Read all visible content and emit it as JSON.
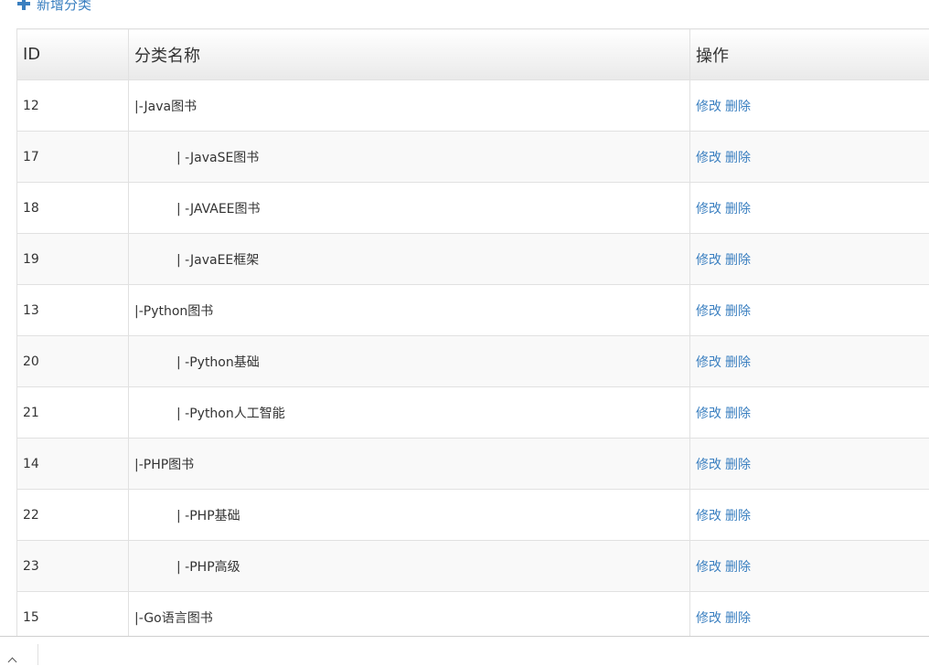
{
  "toolbar": {
    "add_label": "新增分类"
  },
  "table": {
    "headers": {
      "id": "ID",
      "name": "分类名称",
      "actions": "操作"
    },
    "rows": [
      {
        "id": "12",
        "name": "|-Java图书",
        "edit": "修改",
        "delete": "删除"
      },
      {
        "id": "17",
        "name": "| -JavaSE图书",
        "edit": "修改",
        "delete": "删除"
      },
      {
        "id": "18",
        "name": "| -JAVAEE图书",
        "edit": "修改",
        "delete": "删除"
      },
      {
        "id": "19",
        "name": "| -JavaEE框架",
        "edit": "修改",
        "delete": "删除"
      },
      {
        "id": "13",
        "name": "|-Python图书",
        "edit": "修改",
        "delete": "删除"
      },
      {
        "id": "20",
        "name": "| -Python基础",
        "edit": "修改",
        "delete": "删除"
      },
      {
        "id": "21",
        "name": "| -Python人工智能",
        "edit": "修改",
        "delete": "删除"
      },
      {
        "id": "14",
        "name": "|-PHP图书",
        "edit": "修改",
        "delete": "删除"
      },
      {
        "id": "22",
        "name": "| -PHP基础",
        "edit": "修改",
        "delete": "删除"
      },
      {
        "id": "23",
        "name": "| -PHP高级",
        "edit": "修改",
        "delete": "删除"
      },
      {
        "id": "15",
        "name": "|-Go语言图书",
        "edit": "修改",
        "delete": "删除"
      }
    ]
  },
  "colors": {
    "link": "#3a7fc0",
    "text": "#333333",
    "border": "#e1e1e1",
    "stripe": "#f9f9f9"
  },
  "icons": {
    "add": "plus-icon",
    "bottom": "chevron-up-icon"
  }
}
